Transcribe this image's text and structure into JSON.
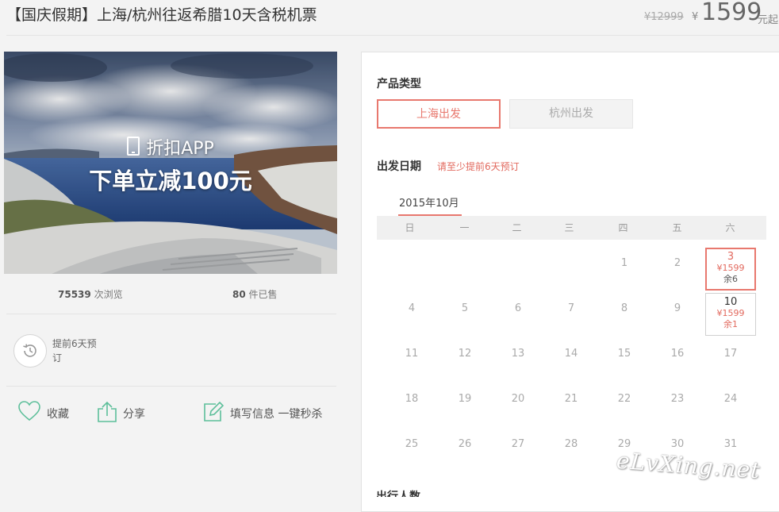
{
  "header": {
    "title": "【国庆假期】上海/杭州往返希腊10天含税机票",
    "old_price": "¥12999",
    "currency": "¥",
    "price": "1599",
    "price_suffix": "元起"
  },
  "hero": {
    "app_line": "折扣APP",
    "promo_line": "下单立减100元"
  },
  "stats": {
    "views_count": "75539",
    "views_label": "次浏览",
    "sold_count": "80",
    "sold_label": "件已售"
  },
  "advance_notice": "提前6天预订",
  "actions": {
    "favorite": "收藏",
    "share": "分享",
    "fill_info": "填写信息 一键秒杀"
  },
  "product_type": {
    "label": "产品类型",
    "options": [
      "上海出发",
      "杭州出发"
    ],
    "selected": "上海出发"
  },
  "departure": {
    "label": "出发日期",
    "hint": "请至少提前6天预订",
    "month": "2015年10月",
    "weekdays": [
      "日",
      "一",
      "二",
      "三",
      "四",
      "五",
      "六"
    ],
    "days": {
      "d1": "1",
      "d2": "2",
      "d3": "3",
      "d4": "4",
      "d5": "5",
      "d6": "6",
      "d7": "7",
      "d8": "8",
      "d9": "9",
      "d10": "10",
      "d11": "11",
      "d12": "12",
      "d13": "13",
      "d14": "14",
      "d15": "15",
      "d16": "16",
      "d17": "17",
      "d18": "18",
      "d19": "19",
      "d20": "20",
      "d21": "21",
      "d22": "22",
      "d23": "23",
      "d24": "24",
      "d25": "25",
      "d26": "26",
      "d27": "27",
      "d28": "28",
      "d29": "29",
      "d30": "30",
      "d31": "31"
    },
    "available": {
      "d3": {
        "price": "¥1599",
        "remaining": "余6"
      },
      "d10": {
        "price": "¥1599",
        "remaining": "余1"
      }
    }
  },
  "next_section_label": "出行人数",
  "watermark": "eLvXing.net",
  "colors": {
    "accent": "#e8786e",
    "accent_text": "#e2695e",
    "background": "#f3f3f3"
  }
}
